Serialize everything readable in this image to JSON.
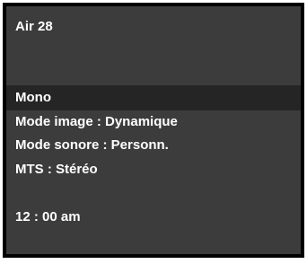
{
  "channel": {
    "label": "Air 28"
  },
  "info_items": [
    {
      "label": "Mono",
      "selected": true
    },
    {
      "label": "Mode image : Dynamique",
      "selected": false
    },
    {
      "label": "Mode sonore : Personn.",
      "selected": false
    },
    {
      "label": "MTS : Stéréo",
      "selected": false
    }
  ],
  "clock": {
    "time": "12 : 00 am"
  },
  "colors": {
    "panel_background": "#3c3c3c",
    "selected_row": "#252525",
    "frame_border": "#000000",
    "text": "#ffffff"
  }
}
